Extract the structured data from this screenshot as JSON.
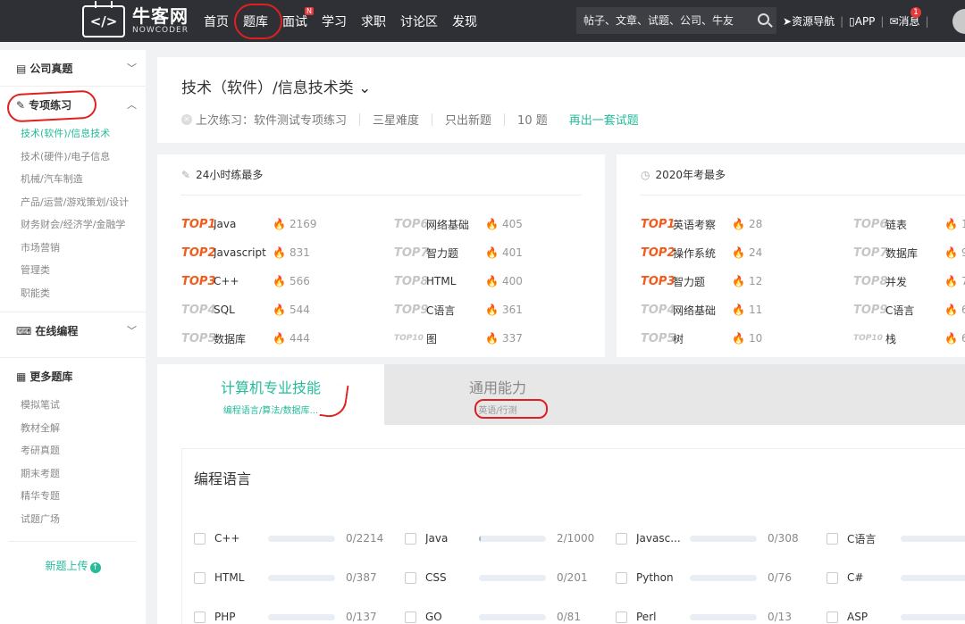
{
  "logo": {
    "mark": "</>",
    "cn": "牛客网",
    "en": "NOWCODER"
  },
  "nav": [
    {
      "label": "首页"
    },
    {
      "label": "题库"
    },
    {
      "label": "面试",
      "badge": "N"
    },
    {
      "label": "学习"
    },
    {
      "label": "求职"
    },
    {
      "label": "讨论区"
    },
    {
      "label": "发现"
    }
  ],
  "search": {
    "placeholder": "帖子、文章、试题、公司、牛友"
  },
  "topright": {
    "resource": "资源导航",
    "app": "APP",
    "msg": "消息",
    "msg_count": "1"
  },
  "sidebar": {
    "group1": {
      "label": "公司真题"
    },
    "group2": {
      "label": "专项练习",
      "items": [
        "技术(软件)/信息技术",
        "技术(硬件)/电子信息",
        "机械/汽车制造",
        "产品/运营/游戏策划/设计",
        "财务财会/经济学/金融学",
        "市场营销",
        "管理类",
        "职能类"
      ]
    },
    "group3": {
      "label": "在线编程"
    },
    "group4": {
      "label": "更多题库",
      "items": [
        "模拟笔试",
        "教材全解",
        "考研真题",
        "期末考题",
        "精华专题",
        "试题广场"
      ]
    },
    "upload": "新题上传"
  },
  "header": {
    "title": "技术（软件）/信息技术类",
    "last": "上次练习：软件测试专项练习",
    "difficulty": "三星难度",
    "only_new": "只出新题",
    "count": "10 题",
    "again": "再出一套试题"
  },
  "rank_left": {
    "title": "24小时练最多",
    "col1": [
      {
        "tag": "TOP1",
        "name": "Java",
        "count": "2169"
      },
      {
        "tag": "TOP2",
        "name": "Javascript",
        "count": "831"
      },
      {
        "tag": "TOP3",
        "name": "C++",
        "count": "566"
      },
      {
        "tag": "TOP4",
        "name": "SQL",
        "count": "544"
      },
      {
        "tag": "TOP5",
        "name": "数据库",
        "count": "444"
      }
    ],
    "col2": [
      {
        "tag": "TOP6",
        "name": "网络基础",
        "count": "405"
      },
      {
        "tag": "TOP7",
        "name": "智力题",
        "count": "401"
      },
      {
        "tag": "TOP8",
        "name": "HTML",
        "count": "400"
      },
      {
        "tag": "TOP9",
        "name": "C语言",
        "count": "361"
      },
      {
        "tag": "TOP10",
        "name": "图",
        "count": "337"
      }
    ]
  },
  "rank_right": {
    "title": "2020年考最多",
    "col1": [
      {
        "tag": "TOP1",
        "name": "英语考察",
        "count": "28"
      },
      {
        "tag": "TOP2",
        "name": "操作系统",
        "count": "24"
      },
      {
        "tag": "TOP3",
        "name": "智力题",
        "count": "12"
      },
      {
        "tag": "TOP4",
        "name": "网络基础",
        "count": "11"
      },
      {
        "tag": "TOP5",
        "name": "树",
        "count": "10"
      }
    ],
    "col2": [
      {
        "tag": "TOP6",
        "name": "链表",
        "count": "1"
      },
      {
        "tag": "TOP7",
        "name": "数据库",
        "count": "9"
      },
      {
        "tag": "TOP8",
        "name": "并发",
        "count": "7"
      },
      {
        "tag": "TOP9",
        "name": "C语言",
        "count": "6"
      },
      {
        "tag": "TOP10",
        "name": "栈",
        "count": "6"
      }
    ]
  },
  "tabs": [
    {
      "name": "计算机专业技能",
      "sub": "编程语言/算法/数据库..."
    },
    {
      "name": "通用能力",
      "sub": "英语/行测"
    }
  ],
  "skills": {
    "title": "编程语言",
    "rows": [
      [
        {
          "name": "C++",
          "count": "0/2214",
          "progress": 0
        },
        {
          "name": "Java",
          "count": "2/1000",
          "progress": 0.002
        },
        {
          "name": "Javasc...",
          "count": "0/308",
          "progress": 0
        },
        {
          "name": "C语言",
          "count": "",
          "progress": 0
        }
      ],
      [
        {
          "name": "HTML",
          "count": "0/387",
          "progress": 0
        },
        {
          "name": "CSS",
          "count": "0/201",
          "progress": 0
        },
        {
          "name": "Python",
          "count": "0/76",
          "progress": 0
        },
        {
          "name": "C#",
          "count": "",
          "progress": 0
        }
      ],
      [
        {
          "name": "PHP",
          "count": "0/137",
          "progress": 0
        },
        {
          "name": "GO",
          "count": "0/81",
          "progress": 0
        },
        {
          "name": "Perl",
          "count": "0/13",
          "progress": 0
        },
        {
          "name": "ASP",
          "count": "",
          "progress": 0
        }
      ]
    ]
  }
}
